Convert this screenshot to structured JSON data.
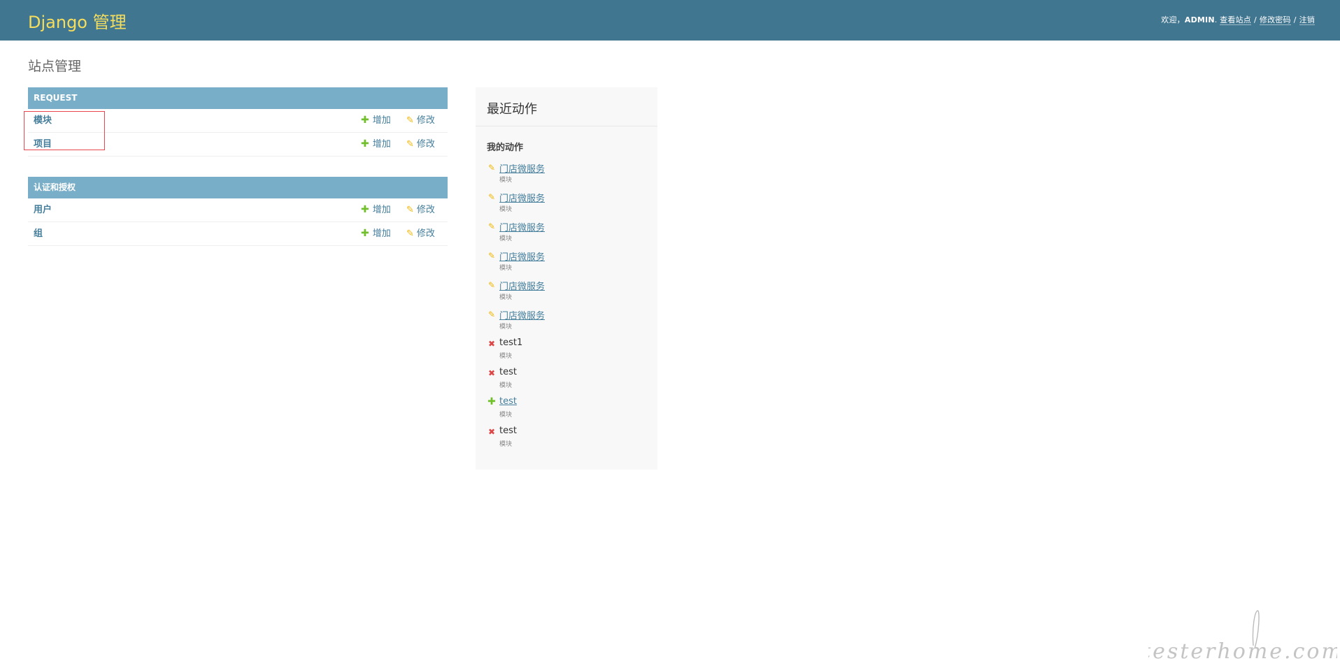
{
  "header": {
    "brand": "Django 管理",
    "welcome": "欢迎，",
    "username": "ADMIN",
    "period": ".",
    "view_site": "查看站点",
    "change_password": "修改密码",
    "logout": "注销",
    "sep": "/"
  },
  "page_title": "站点管理",
  "modules": [
    {
      "caption": "REQUEST",
      "rows": [
        {
          "name": "模块",
          "add": "增加",
          "change": "修改"
        },
        {
          "name": "项目",
          "add": "增加",
          "change": "修改"
        }
      ]
    },
    {
      "caption": "认证和授权",
      "rows": [
        {
          "name": "用户",
          "add": "增加",
          "change": "修改"
        },
        {
          "name": "组",
          "add": "增加",
          "change": "修改"
        }
      ]
    }
  ],
  "recent": {
    "title": "最近动作",
    "subtitle": "我的动作",
    "actions": [
      {
        "icon": "pencil-icon",
        "name": "门店微服务",
        "type": "模块",
        "kind": "change",
        "linked": true
      },
      {
        "icon": "pencil-icon",
        "name": "门店微服务",
        "type": "模块",
        "kind": "change",
        "linked": true
      },
      {
        "icon": "pencil-icon",
        "name": "门店微服务",
        "type": "模块",
        "kind": "change",
        "linked": true
      },
      {
        "icon": "pencil-icon",
        "name": "门店微服务",
        "type": "模块",
        "kind": "change",
        "linked": true
      },
      {
        "icon": "pencil-icon",
        "name": "门店微服务",
        "type": "模块",
        "kind": "change",
        "linked": true
      },
      {
        "icon": "pencil-icon",
        "name": "门店微服务",
        "type": "模块",
        "kind": "change",
        "linked": true
      },
      {
        "icon": "delete-icon",
        "name": "test1",
        "type": "模块",
        "kind": "delete",
        "linked": false
      },
      {
        "icon": "delete-icon",
        "name": "test",
        "type": "模块",
        "kind": "delete",
        "linked": false
      },
      {
        "icon": "plus-icon",
        "name": "test",
        "type": "模块",
        "kind": "add",
        "linked": true
      },
      {
        "icon": "delete-icon",
        "name": "test",
        "type": "模块",
        "kind": "delete",
        "linked": false
      }
    ]
  },
  "watermark": "testerhome.com",
  "colors": {
    "header_bg": "#417690",
    "brand": "#f5dd5d",
    "caption_bg": "#79aec8",
    "link": "#447e9b",
    "add_icon": "#70bf2b",
    "change_icon": "#efb80b",
    "delete_icon": "#dd4646",
    "highlight_box": "#e8474d"
  }
}
